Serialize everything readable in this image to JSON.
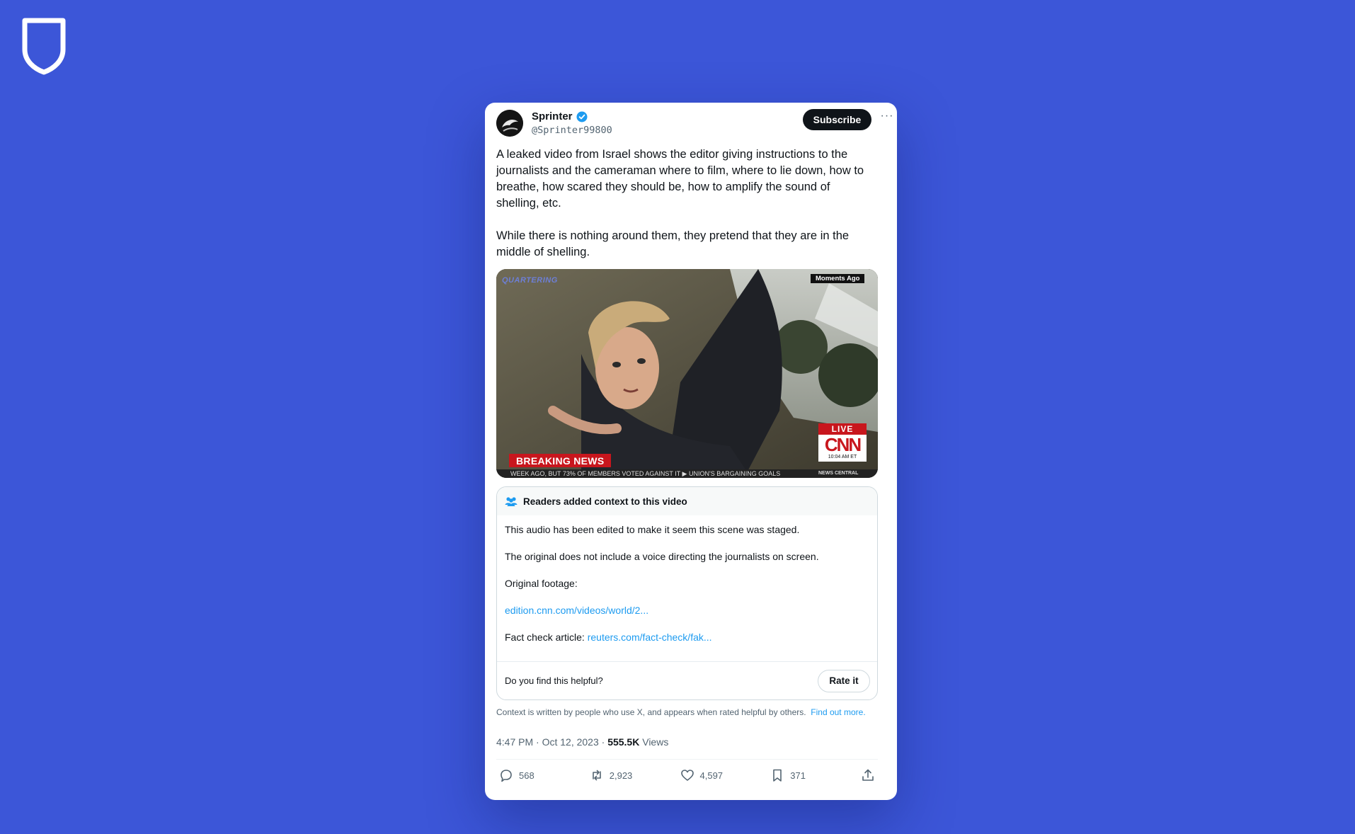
{
  "post": {
    "author_name": "Sprinter",
    "author_handle": "@Sprinter99800",
    "subscribe_label": "Subscribe",
    "more_label": "···",
    "paragraphs": [
      "A leaked video from Israel shows the editor giving instructions to the journalists and the cameraman where to film, where to lie down, how to breathe, how scared they should be, how to amplify the sound of shelling, etc.",
      "While there is nothing around them, they pretend that they are in the middle of shelling."
    ]
  },
  "video": {
    "watermark": "QUARTERING",
    "moments_badge": "Moments Ago",
    "breaking_news": "BREAKING NEWS",
    "ticker": "WEEK AGO, BUT 73% OF MEMBERS VOTED AGAINST IT  ▶ UNION'S BARGAINING GOALS",
    "live_label": "LIVE",
    "network": "CNN",
    "time": "10:04 AM ET",
    "channel": "NEWS CENTRAL"
  },
  "context_note": {
    "title": "Readers added context to this video",
    "lines": [
      "This audio has been edited to make it seem this scene was staged.",
      "The original does not include a voice directing the journalists on screen.",
      "Original footage:"
    ],
    "footage_link": "edition.cnn.com/videos/world/2...",
    "fact_check_prefix": "Fact check article: ",
    "fact_check_link": "reuters.com/fact-check/fak...",
    "helpful_question": "Do you find this helpful?",
    "rate_label": "Rate it",
    "disclaimer": "Context is written by people who use X, and appears when rated helpful by others.",
    "find_out_more": "Find out more."
  },
  "meta": {
    "timestamp": "4:47 PM · Oct 12, 2023 · ",
    "views_count": "555.5K",
    "views_label": " Views"
  },
  "actions": {
    "replies": "568",
    "reposts": "2,923",
    "likes": "4,597",
    "bookmarks": "371"
  },
  "colors": {
    "background": "#3c56d8",
    "link": "#1d9bf0",
    "breaking": "#c8161d"
  }
}
